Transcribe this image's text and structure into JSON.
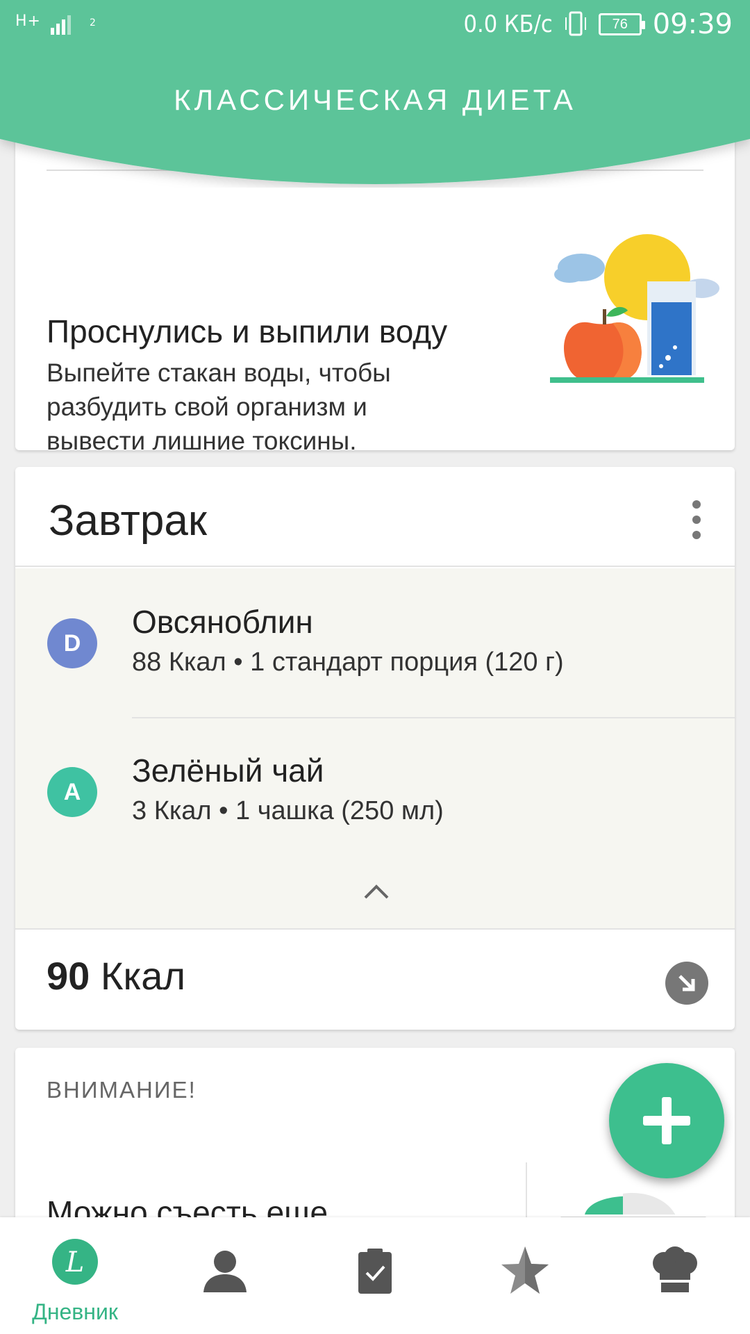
{
  "status_bar": {
    "network": "H+",
    "sim": "2",
    "speed": "0.0 КБ/с",
    "battery": "76",
    "time": "09:39"
  },
  "header": {
    "title": "КЛАССИЧЕСКАЯ ДИЕТА",
    "color": "#5cc499"
  },
  "tip": {
    "title": "Проснулись и выпили воду",
    "text": "Выпейте стакан воды, чтобы разбудить свой организм и вывести лишние токсины.",
    "illustration": "apple-water-sun-illustration"
  },
  "meal": {
    "title": "Завтрак",
    "items": [
      {
        "badge": "D",
        "badge_color": "#7088d0",
        "name": "Овсяноблин",
        "desc": "88 Ккал • 1 стандарт порция (120 г)"
      },
      {
        "badge": "A",
        "badge_color": "#3fc2a2",
        "name": "Зелёный чай",
        "desc": "3 Ккал • 1 чашка (250 мл)"
      }
    ],
    "total_value": "90",
    "total_unit": " Ккал"
  },
  "attention": {
    "label": "ВНИМАНИЕ!",
    "text": "Можно съесть еще"
  },
  "fab": {
    "icon": "plus-icon",
    "color": "#3dbf8e"
  },
  "nav": {
    "active_color": "#35b485",
    "items": [
      {
        "icon": "diary-icon",
        "label": "Дневник",
        "active": true
      },
      {
        "icon": "profile-icon",
        "label": "",
        "active": false
      },
      {
        "icon": "clipboard-check-icon",
        "label": "",
        "active": false
      },
      {
        "icon": "star-icon",
        "label": "",
        "active": false
      },
      {
        "icon": "chef-hat-icon",
        "label": "",
        "active": false
      }
    ]
  }
}
